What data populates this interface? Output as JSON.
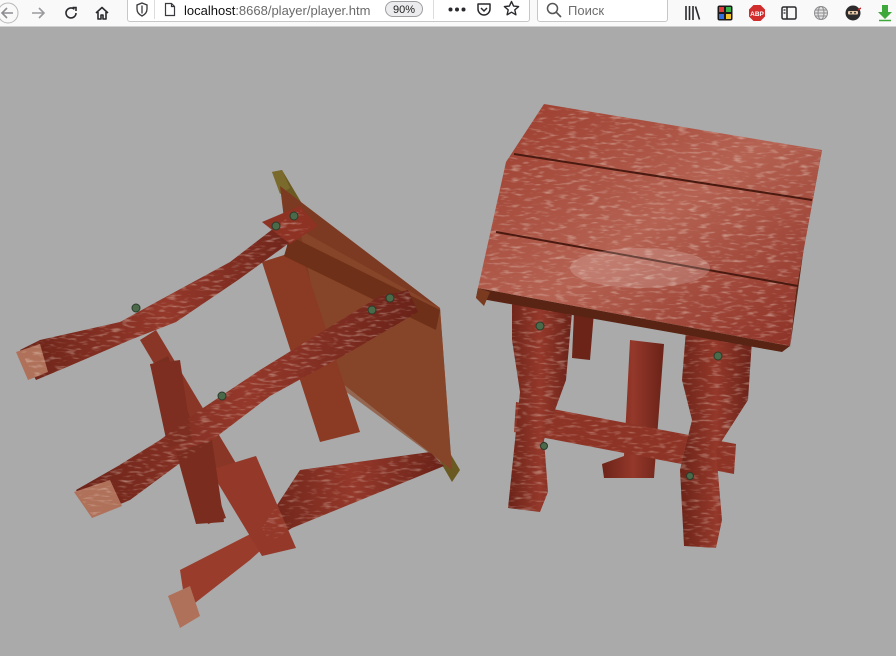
{
  "browser": {
    "url_host": "localhost",
    "url_path": ":8668/player/player.htm",
    "zoom": "90%",
    "search_placeholder": "Поиск",
    "extensions": {
      "abp_label": "ABP"
    }
  },
  "colors": {
    "background": "#aaaaaa",
    "wood_red": "#8e2e22",
    "wood_light": "#c9a28b",
    "toolbar": "#f9f9fa"
  },
  "scene": {
    "objects": [
      "stool-upside-down",
      "stool-upright"
    ]
  }
}
